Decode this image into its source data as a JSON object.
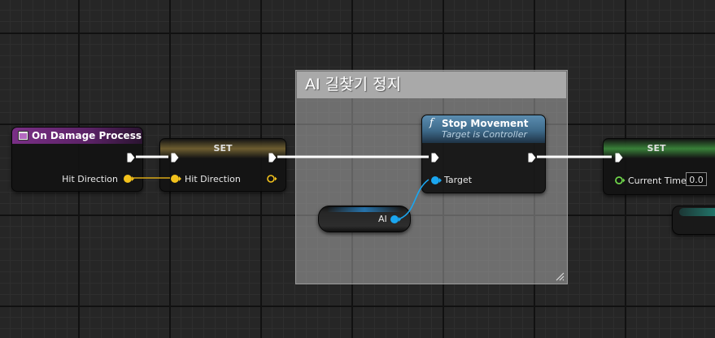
{
  "comment": {
    "title": "AI 길찾기 정지"
  },
  "event_node": {
    "title": "On Damage Process",
    "output_pin": "Hit Direction",
    "color": "#7a2f86"
  },
  "set_node_1": {
    "title": "SET",
    "input_pin": "Hit Direction",
    "color": "#7d6a35"
  },
  "function_node": {
    "icon": "f",
    "title": "Stop Movement",
    "subtitle": "Target is Controller",
    "input_pin": "Target",
    "color": "#4a7a9a"
  },
  "ai_variable": {
    "label": "AI",
    "color": "#2b9de4"
  },
  "set_node_2": {
    "title": "SET",
    "input_pin": "Current Time",
    "value": "0.0",
    "color": "#3d7d3d"
  },
  "colors": {
    "exec_wire": "#ffffff",
    "vector_pin": "#f3c21c",
    "object_pin": "#1aa6f0",
    "float_pin": "#6ed44a"
  }
}
